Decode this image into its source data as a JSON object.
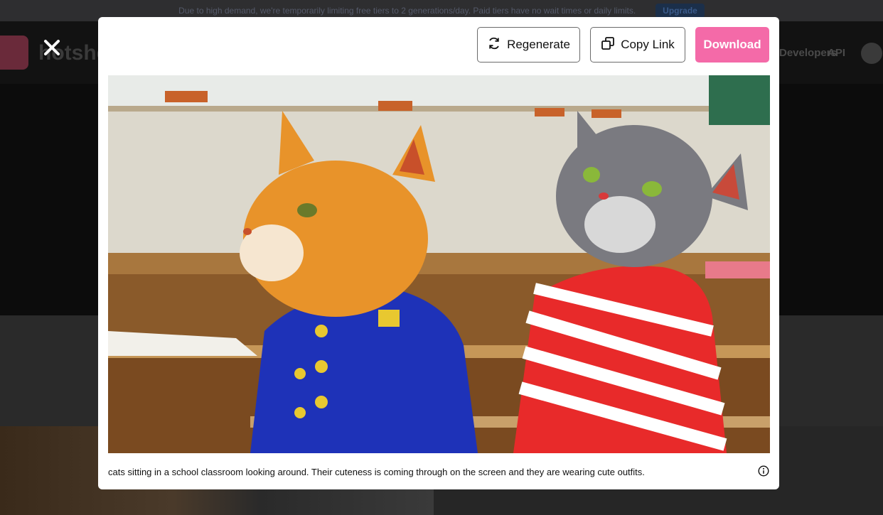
{
  "banner": {
    "text": "Due to high demand, we're temporarily limiting free tiers to 2 generations/day. Paid tiers have no wait times or daily limits.",
    "upgrade_label": "Upgrade"
  },
  "background": {
    "logo_text": "hotshot",
    "nav": [
      "Developers",
      "API"
    ]
  },
  "modal": {
    "buttons": {
      "regenerate": "Regenerate",
      "copy_link": "Copy Link",
      "download": "Download"
    },
    "image": {
      "alt": "Two cats in a classroom: an orange tabby wearing a blue jacket with gold buttons and a grey tabby in a red and white striped shirt"
    },
    "caption": "cats sitting in a school classroom looking around. Their cuteness is coming through on the screen and they are wearing cute outfits.",
    "icons": {
      "close": "close-icon",
      "regenerate": "refresh-icon",
      "copy": "copy-icon",
      "info": "info-icon"
    }
  },
  "colors": {
    "download_button": "#f46aa8",
    "modal_bg": "#ffffff",
    "overlay": "#1a1a1a"
  }
}
